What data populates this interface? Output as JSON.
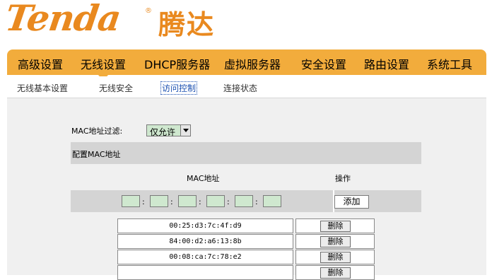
{
  "brand": {
    "logo_text": "Tenda",
    "reg_mark": "®",
    "cn_name": "腾达",
    "color": "#e9891f"
  },
  "nav": {
    "accent": "#f2ac3c",
    "items": [
      "高级设置",
      "无线设置",
      "DHCP服务器",
      "虚拟服务器",
      "安全设置",
      "路由设置",
      "系统工具"
    ]
  },
  "subnav": {
    "items": [
      "无线基本设置",
      "无线安全",
      "访问控制",
      "连接状态"
    ],
    "active": "访问控制"
  },
  "form": {
    "mac_filter_label": "MAC地址过滤:",
    "mac_filter_value": "仅允许",
    "config_heading": "配置MAC地址",
    "col_mac": "MAC地址",
    "col_op": "操作",
    "add_label": "添加",
    "octets": [
      "",
      "",
      "",
      "",
      "",
      ""
    ],
    "colon": ":"
  },
  "mac_list": [
    {
      "mac": "00:25:d3:7c:4f:d9",
      "action": "删除"
    },
    {
      "mac": "84:00:d2:a6:13:8b",
      "action": "删除"
    },
    {
      "mac": "00:08:ca:7c:78:e2",
      "action": "删除"
    },
    {
      "mac": "",
      "action": "删除"
    }
  ]
}
